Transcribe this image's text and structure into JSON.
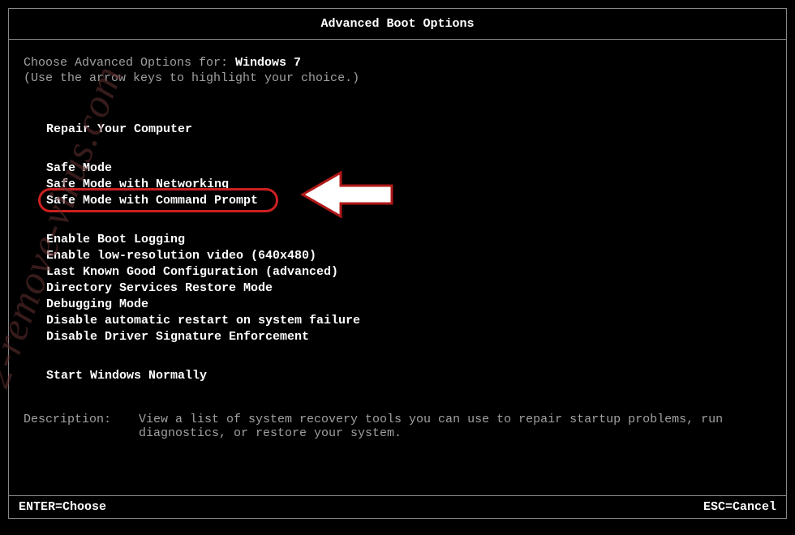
{
  "title": "Advanced Boot Options",
  "intro": {
    "prefix": "Choose Advanced Options for: ",
    "os": "Windows 7",
    "hint": "(Use the arrow keys to highlight your choice.)"
  },
  "group_repair": {
    "item0": "Repair Your Computer"
  },
  "group_safe": {
    "item0": "Safe Mode",
    "item1": "Safe Mode with Networking",
    "item2": "Safe Mode with Command Prompt"
  },
  "group_advanced": {
    "item0": "Enable Boot Logging",
    "item1": "Enable low-resolution video (640x480)",
    "item2": "Last Known Good Configuration (advanced)",
    "item3": "Directory Services Restore Mode",
    "item4": "Debugging Mode",
    "item5": "Disable automatic restart on system failure",
    "item6": "Disable Driver Signature Enforcement"
  },
  "group_normal": {
    "item0": "Start Windows Normally"
  },
  "description": {
    "label": "Description:",
    "text": "View a list of system recovery tools you can use to repair startup problems, run diagnostics, or restore your system."
  },
  "footer": {
    "enter": "ENTER=Choose",
    "esc": "ESC=Cancel"
  },
  "watermark": "2-remove-virus.com",
  "annotation": {
    "highlighted_item": "Safe Mode with Command Prompt",
    "circle_color": "#cc2020",
    "arrow_color": "#ffffff"
  }
}
